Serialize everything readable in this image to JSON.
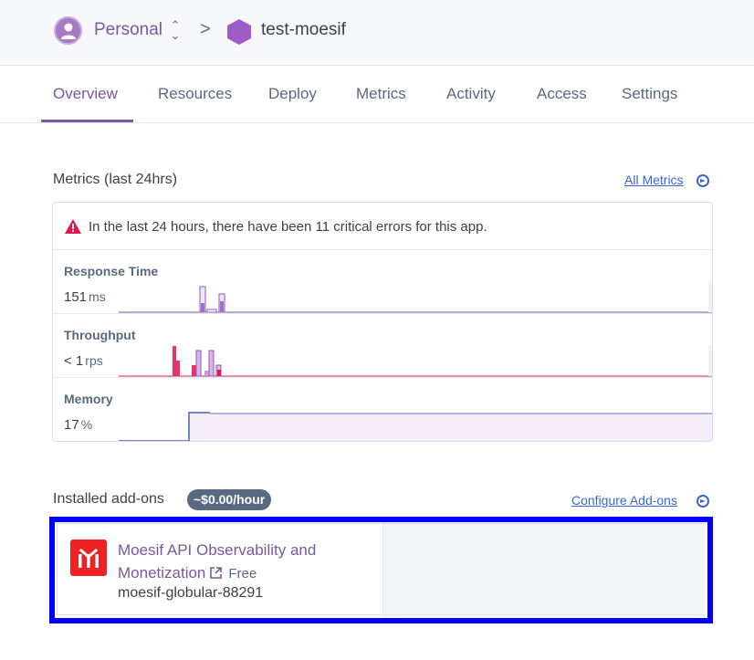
{
  "header": {
    "space_name": "Personal",
    "space_toggle_icon": "chevron-updown-icon",
    "separator": ">",
    "app_name": "test-moesif",
    "app_icon": "hexagon-icon"
  },
  "tabs": [
    {
      "label": "Overview",
      "active": true
    },
    {
      "label": "Resources",
      "active": false
    },
    {
      "label": "Deploy",
      "active": false
    },
    {
      "label": "Metrics",
      "active": false
    },
    {
      "label": "Activity",
      "active": false
    },
    {
      "label": "Access",
      "active": false
    },
    {
      "label": "Settings",
      "active": false
    }
  ],
  "metrics": {
    "title": "Metrics (last 24hrs)",
    "all_link": "All Metrics",
    "alert": "In the last 24 hours, there have been 11 critical errors for this app.",
    "rows": [
      {
        "label": "Response Time",
        "value": "151",
        "unit": "ms"
      },
      {
        "label": "Throughput",
        "value": "< 1",
        "unit": "rps"
      },
      {
        "label": "Memory",
        "value": "17",
        "unit": "%"
      }
    ]
  },
  "addons": {
    "title": "Installed add-ons",
    "cost_badge": "~$0.00/hour",
    "configure_link": "Configure Add-ons",
    "items": [
      {
        "name": "Moesif API Observability and Monetization",
        "plan": "Free",
        "resource": "moesif-globular-88291",
        "logo_icon": "moesif-logo-icon"
      }
    ]
  },
  "colors": {
    "brand_purple": "#79589f",
    "link_blue": "#3b64d9",
    "error_red": "#e3184a",
    "highlight_frame": "#0000ff",
    "addon_logo_red": "#ee2222"
  }
}
